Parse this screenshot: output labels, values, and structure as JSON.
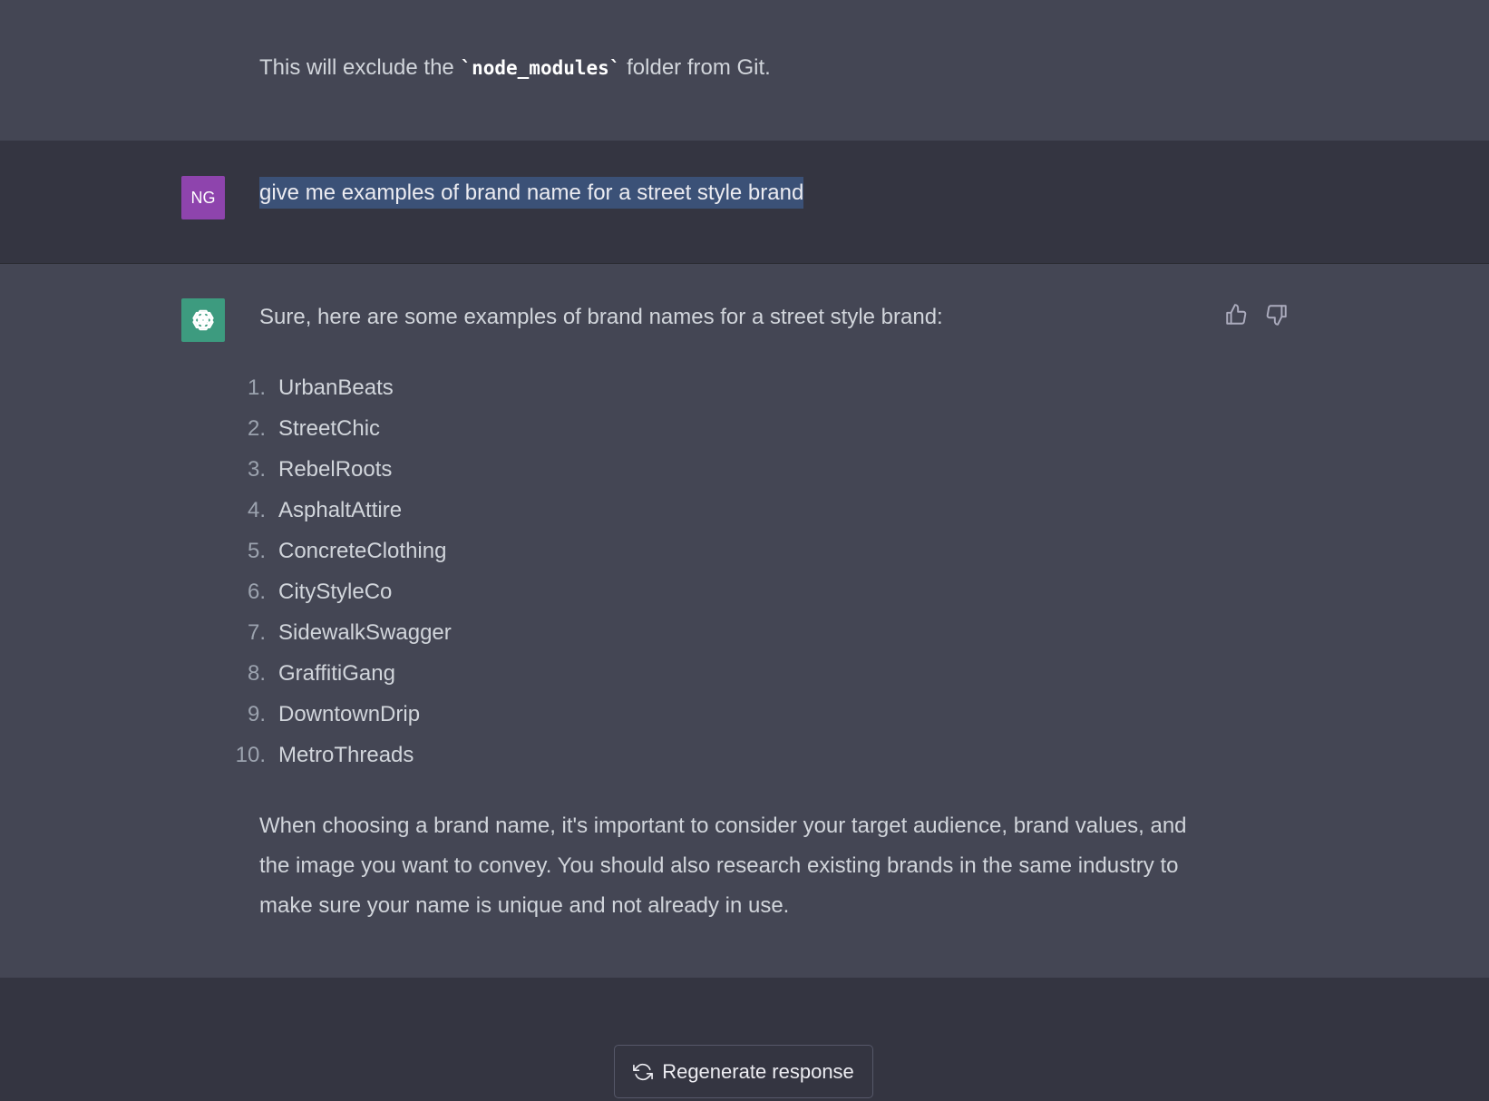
{
  "previous_message": {
    "prefix": "This will exclude the ",
    "code": "`node_modules`",
    "suffix": " folder from Git."
  },
  "user_message": {
    "avatar_initials": "NG",
    "text": "give me examples of brand name for a street style brand"
  },
  "assistant_message": {
    "intro": "Sure, here are some examples of brand names for a street style brand:",
    "list": [
      {
        "num": "1.",
        "name": "UrbanBeats"
      },
      {
        "num": "2.",
        "name": "StreetChic"
      },
      {
        "num": "3.",
        "name": "RebelRoots"
      },
      {
        "num": "4.",
        "name": "AsphaltAttire"
      },
      {
        "num": "5.",
        "name": "ConcreteClothing"
      },
      {
        "num": "6.",
        "name": "CityStyleCo"
      },
      {
        "num": "7.",
        "name": "SidewalkSwagger"
      },
      {
        "num": "8.",
        "name": "GraffitiGang"
      },
      {
        "num": "9.",
        "name": "DowntownDrip"
      },
      {
        "num": "10.",
        "name": "MetroThreads"
      }
    ],
    "closing": "When choosing a brand name, it's important to consider your target audience, brand values, and the image you want to convey. You should also research existing brands in the same industry to make sure your name is unique and not already in use.",
    "icons": {
      "avatar": "openai-logo-icon",
      "up": "thumbs-up-icon",
      "down": "thumbs-down-icon"
    }
  },
  "footer": {
    "regenerate_label": "Regenerate response",
    "regenerate_icon": "refresh-icon"
  },
  "colors": {
    "assistant_bg": "#444654",
    "user_bg": "#343541",
    "user_avatar": "#8e44ad",
    "assistant_avatar": "#3d9b7f",
    "selection": "#3b5177"
  }
}
